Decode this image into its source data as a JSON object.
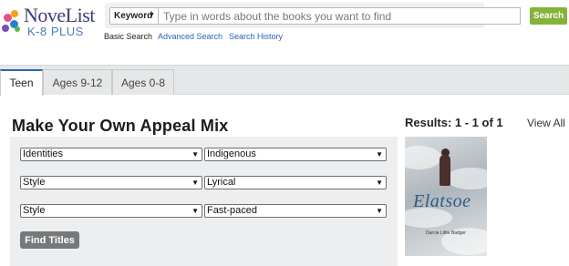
{
  "brand": {
    "name": "NoveList",
    "sub": "K-8 PLUS"
  },
  "search": {
    "field_label": "Keyword",
    "placeholder": "Type in words about the books you want to find",
    "button": "Search",
    "help": "?",
    "links": {
      "basic": "Basic Search",
      "advanced": "Advanced Search",
      "history": "Search History"
    }
  },
  "tabs": [
    {
      "label": "Teen",
      "active": true
    },
    {
      "label": "Ages 9-12",
      "active": false
    },
    {
      "label": "Ages 0-8",
      "active": false
    }
  ],
  "appeal_mix": {
    "title": "Make Your Own Appeal Mix",
    "rows": [
      {
        "category": "Identities",
        "value": "Indigenous"
      },
      {
        "category": "Style",
        "value": "Lyrical"
      },
      {
        "category": "Style",
        "value": "Fast-paced"
      }
    ],
    "button": "Find Titles"
  },
  "results": {
    "label": "Results: 1 - 1 of 1",
    "view_all": "View All",
    "cover": {
      "title": "Elatsoe",
      "author": "Darcie Little Badger"
    }
  },
  "colors": {
    "accent_blue": "#2a63b8",
    "search_green": "#84b33a",
    "panel_gray": "#eceeef"
  }
}
